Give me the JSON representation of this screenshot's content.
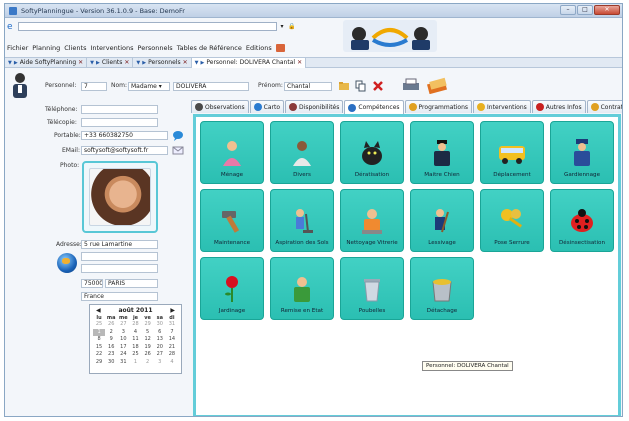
{
  "window": {
    "title": "SoftyPlanningue - Version 36.1.0.9 - Base: DemoFr"
  },
  "menu": [
    "Fichier",
    "Planning",
    "Clients",
    "Interventions",
    "Personnels",
    "Tables de Référence",
    "Editions"
  ],
  "doc_tabs": [
    {
      "label": "Aide SoftyPlanning",
      "active": false
    },
    {
      "label": "Clients",
      "active": false
    },
    {
      "label": "Personnels",
      "active": false
    },
    {
      "label": "Personnel: DOLIVERA Chantal",
      "active": true
    }
  ],
  "form": {
    "personnel_label": "Personnel:",
    "personnel_value": "7",
    "nom_label": "Nom:",
    "civilite": "Madame",
    "nom_value": "DOLIVERA",
    "prenom_label": "Prénom:",
    "prenom_value": "Chantal",
    "telephone_label": "Téléphone:",
    "telecopie_label": "Télécopie:",
    "portable_label": "Portable:",
    "portable_value": "+33 660382750",
    "email_label": "EMail:",
    "email_value": "softysoft@softysoft.fr",
    "photo_label": "Photo:",
    "adresse_label": "Adresse:",
    "adresse_value": "5 rue Lamartine",
    "cp_value": "75000",
    "ville_value": "PARIS",
    "pays_value": "France"
  },
  "calendar": {
    "title": "août 2011",
    "days_header": [
      "lu",
      "ma",
      "me",
      "je",
      "ve",
      "sa",
      "di"
    ],
    "rows": [
      [
        "25",
        "26",
        "27",
        "28",
        "29",
        "30",
        "31"
      ],
      [
        "1",
        "2",
        "3",
        "4",
        "5",
        "6",
        "7"
      ],
      [
        "8",
        "9",
        "10",
        "11",
        "12",
        "13",
        "14"
      ],
      [
        "15",
        "16",
        "17",
        "18",
        "19",
        "20",
        "21"
      ],
      [
        "22",
        "23",
        "24",
        "25",
        "26",
        "27",
        "28"
      ],
      [
        "29",
        "30",
        "31",
        "1",
        "2",
        "3",
        "4"
      ]
    ]
  },
  "subtabs": [
    {
      "label": "Observations",
      "active": false,
      "color": "#4a4a4a"
    },
    {
      "label": "Carto",
      "active": false,
      "color": "#2a7bd0"
    },
    {
      "label": "Disponibilités",
      "active": false,
      "color": "#8b3a3a"
    },
    {
      "label": "Compétences",
      "active": true,
      "color": "#2b6fc3"
    },
    {
      "label": "Programmations",
      "active": false,
      "color": "#e0a020"
    },
    {
      "label": "Interventions",
      "active": false,
      "color": "#e8b020"
    },
    {
      "label": "Autres Infos",
      "active": false,
      "color": "#c82020"
    },
    {
      "label": "Contrat",
      "active": false,
      "color": "#e0a020"
    }
  ],
  "competences": [
    {
      "label": "Ménage",
      "icon": "cleaning-lady-icon"
    },
    {
      "label": "Divers",
      "icon": "person-icon"
    },
    {
      "label": "Dératisation",
      "icon": "cat-icon"
    },
    {
      "label": "Maitre Chien",
      "icon": "guard-icon"
    },
    {
      "label": "Déplacement",
      "icon": "bus-icon"
    },
    {
      "label": "Gardiennage",
      "icon": "security-guard-icon"
    },
    {
      "label": "Maintenance",
      "icon": "hammer-icon"
    },
    {
      "label": "Aspiration des Sols",
      "icon": "vacuum-icon"
    },
    {
      "label": "Nettoyage Vitrerie",
      "icon": "window-cleaner-icon"
    },
    {
      "label": "Lessivage",
      "icon": "sweeper-icon"
    },
    {
      "label": "Pose Serrure",
      "icon": "keys-icon"
    },
    {
      "label": "Désinsectisation",
      "icon": "ladybug-icon"
    },
    {
      "label": "Jardinage",
      "icon": "rose-icon"
    },
    {
      "label": "Remise en Etat",
      "icon": "worker-icon"
    },
    {
      "label": "Poubelles",
      "icon": "trash-bin-icon"
    },
    {
      "label": "Détachage",
      "icon": "paint-bucket-icon"
    }
  ],
  "tooltip": "Personnel: DOLIVERA Chantal"
}
